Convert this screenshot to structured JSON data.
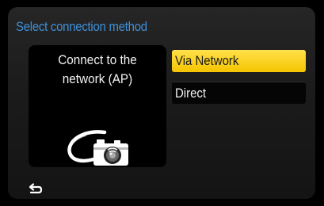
{
  "screen": {
    "title": "Select connection method"
  },
  "info": {
    "line1": "Connect to the",
    "line2": "network (AP)",
    "icon": "camera-network-icon"
  },
  "menu": {
    "options": [
      {
        "label": "Via Network",
        "selected": true
      },
      {
        "label": "Direct",
        "selected": false
      }
    ]
  },
  "footer": {
    "back_icon": "return-icon"
  },
  "colors": {
    "title": "#3f8fd8",
    "highlight": "#f5c400",
    "background": "#1e1e1e"
  }
}
